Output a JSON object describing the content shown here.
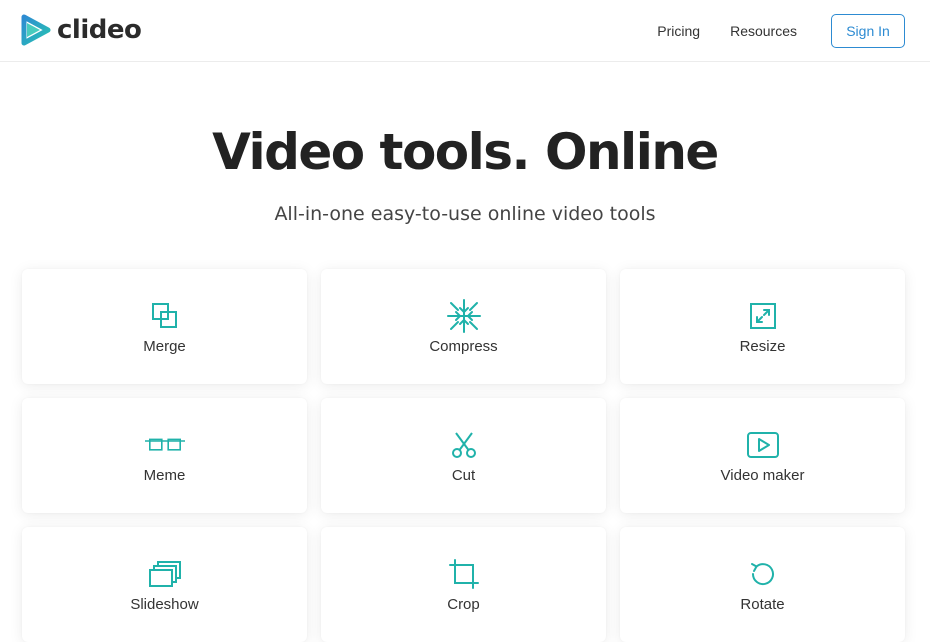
{
  "header": {
    "logo_text": "clideo",
    "nav": [
      {
        "label": "Pricing"
      },
      {
        "label": "Resources"
      }
    ],
    "signin_label": "Sign In"
  },
  "hero": {
    "title": "Video tools. Online",
    "subtitle": "All-in-one easy-to-use online video tools"
  },
  "tools": [
    {
      "label": "Merge",
      "icon": "merge-icon"
    },
    {
      "label": "Compress",
      "icon": "compress-icon"
    },
    {
      "label": "Resize",
      "icon": "resize-icon"
    },
    {
      "label": "Meme",
      "icon": "meme-icon"
    },
    {
      "label": "Cut",
      "icon": "scissors-icon"
    },
    {
      "label": "Video maker",
      "icon": "play-icon"
    },
    {
      "label": "Slideshow",
      "icon": "slideshow-icon"
    },
    {
      "label": "Crop",
      "icon": "crop-icon"
    },
    {
      "label": "Rotate",
      "icon": "rotate-icon"
    }
  ],
  "colors": {
    "accent": "#20b2aa",
    "brand_blue": "#2d8bd2",
    "logo_teal": "#28c3b3"
  }
}
